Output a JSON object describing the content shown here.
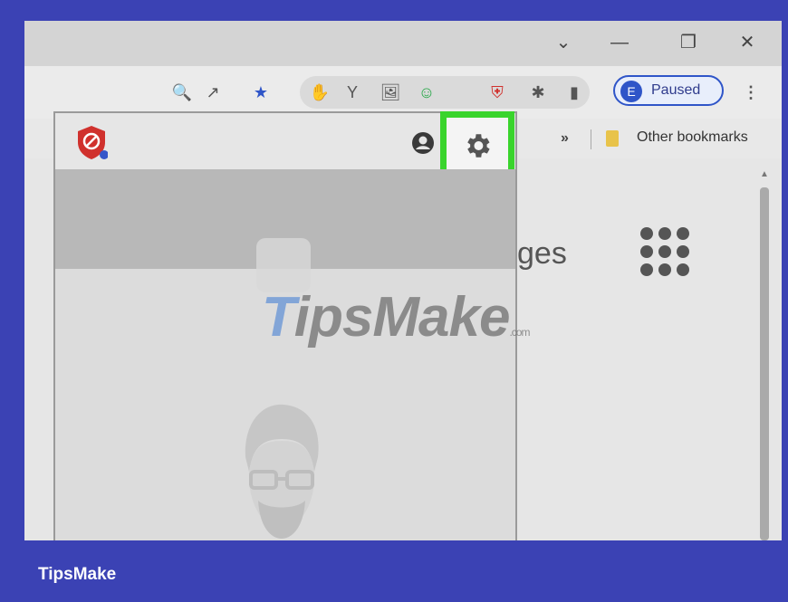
{
  "window": {
    "controls": {
      "dropdown": "⌄",
      "minimize": "—",
      "restore": "❐",
      "close": "✕"
    }
  },
  "toolbar": {
    "icons": {
      "zoom": "🔍",
      "share": "↗",
      "star": "★",
      "extension_1": "✋",
      "extension_2": "Y",
      "extension_3": "🖼",
      "extension_4": "☺",
      "shield_ext": "⛨",
      "puzzle": "✱",
      "side_panel": "▮",
      "menu": "⋮"
    },
    "profile": {
      "initial": "E",
      "status": "Paused"
    }
  },
  "bookmarks": {
    "more": "»",
    "folder": "Other bookmarks"
  },
  "popup": {
    "header_icons": {
      "logo": "⛨",
      "account": "●",
      "settings": "⚙"
    }
  },
  "page": {
    "partial_text": "ges",
    "watermark": {
      "part1": "T",
      "part2": "ipsMake",
      "suffix": ".com"
    }
  },
  "footer": {
    "brand": "TipsMake"
  },
  "colors": {
    "frame_border": "#3b42b4",
    "highlight": "#39d42c",
    "profile_accent": "#2f55c8"
  }
}
